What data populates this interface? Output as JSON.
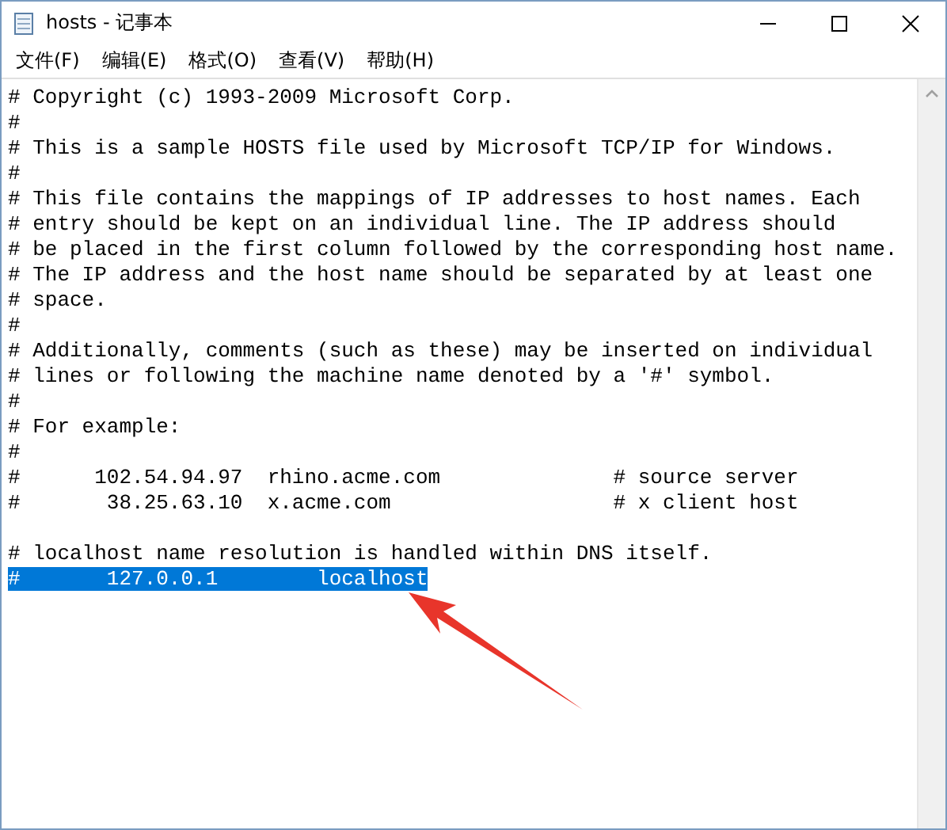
{
  "window": {
    "title": "hosts - 记事本"
  },
  "menu": [
    "文件(F)",
    "编辑(E)",
    "格式(O)",
    "查看(V)",
    "帮助(H)"
  ],
  "editor": {
    "lines": [
      {
        "kind": "text",
        "text": "# Copyright (c) 1993-2009 Microsoft Corp.",
        "selected": false
      },
      {
        "kind": "text",
        "text": "#",
        "selected": false
      },
      {
        "kind": "text",
        "text": "# This is a sample HOSTS file used by Microsoft TCP/IP for Windows.",
        "selected": false
      },
      {
        "kind": "text",
        "text": "#",
        "selected": false
      },
      {
        "kind": "text",
        "text": "# This file contains the mappings of IP addresses to host names. Each",
        "selected": false
      },
      {
        "kind": "text",
        "text": "# entry should be kept on an individual line. The IP address should",
        "selected": false
      },
      {
        "kind": "text",
        "text": "# be placed in the first column followed by the corresponding host name.",
        "selected": false
      },
      {
        "kind": "text",
        "text": "# The IP address and the host name should be separated by at least one",
        "selected": false
      },
      {
        "kind": "text",
        "text": "# space.",
        "selected": false
      },
      {
        "kind": "text",
        "text": "#",
        "selected": false
      },
      {
        "kind": "text",
        "text": "# Additionally, comments (such as these) may be inserted on individual",
        "selected": false
      },
      {
        "kind": "text",
        "text": "# lines or following the machine name denoted by a '#' symbol.",
        "selected": false
      },
      {
        "kind": "text",
        "text": "#",
        "selected": false
      },
      {
        "kind": "text",
        "text": "# For example:",
        "selected": false
      },
      {
        "kind": "text",
        "text": "#",
        "selected": false
      },
      {
        "kind": "text",
        "text": "#      102.54.94.97  rhino.acme.com              # source server",
        "selected": false
      },
      {
        "kind": "text",
        "text": "#       38.25.63.10  x.acme.com                  # x client host",
        "selected": false
      },
      {
        "kind": "blank"
      },
      {
        "kind": "text",
        "text": "# localhost name resolution is handled within DNS itself.",
        "selected": false
      },
      {
        "kind": "text",
        "text": "#       127.0.0.1        localhost",
        "selected": true
      }
    ]
  }
}
